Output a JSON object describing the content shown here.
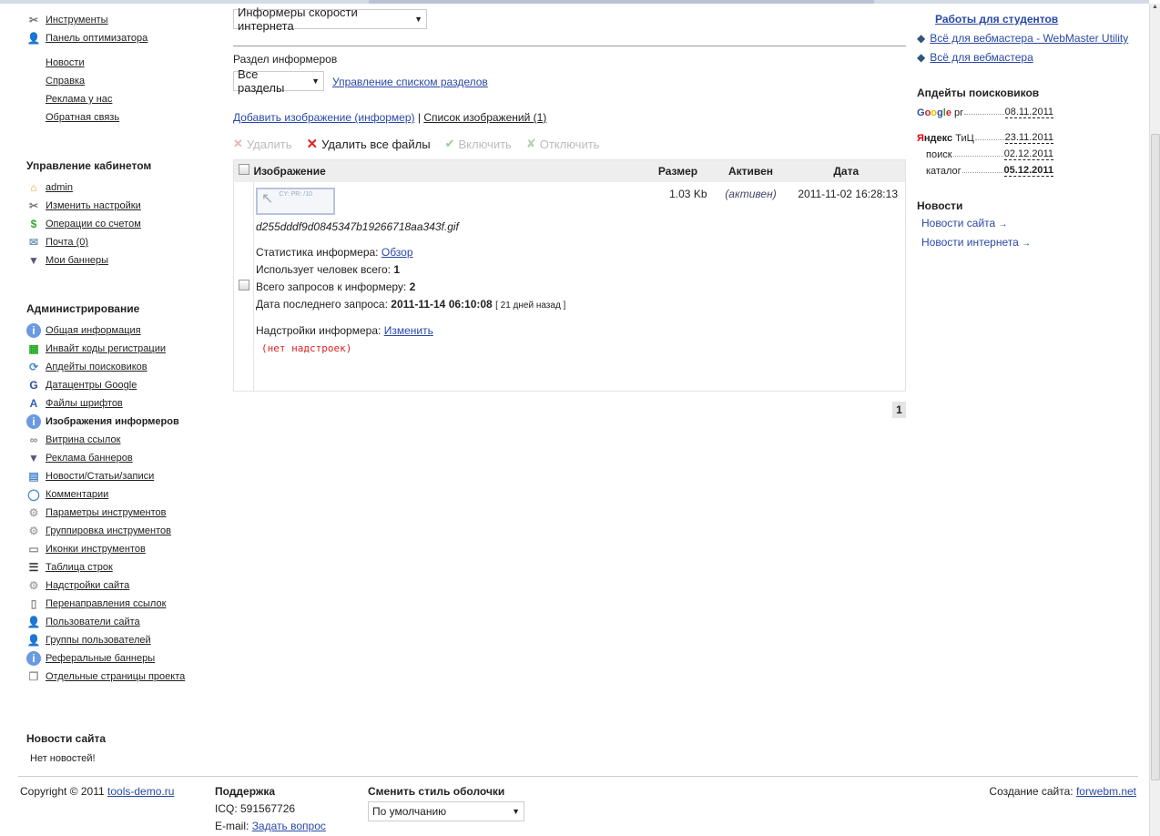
{
  "left_nav": {
    "top_items": [
      {
        "label": "Инструменты",
        "icon": "tools-icon"
      },
      {
        "label": "Панель оптимизатора",
        "icon": "user-icon"
      }
    ],
    "links": [
      "Новости",
      "Справка",
      "Реклама у нас",
      "Обратная связь"
    ],
    "cabinet": {
      "title": "Управление кабинетом",
      "items": [
        {
          "label": "admin",
          "icon": "home-icon"
        },
        {
          "label": "Изменить настройки",
          "icon": "tools-icon"
        },
        {
          "label": "Операции со счетом",
          "icon": "dollar-icon"
        },
        {
          "label": "Почта (0)",
          "icon": "mail-icon"
        },
        {
          "label": "Мои баннеры",
          "icon": "banner-icon"
        }
      ]
    },
    "admin": {
      "title": "Администрирование",
      "items": [
        {
          "label": "Общая информация",
          "icon": "info-icon"
        },
        {
          "label": "Инвайт коды регистрации",
          "icon": "code-icon"
        },
        {
          "label": "Апдейты поисковиков",
          "icon": "refresh-icon"
        },
        {
          "label": "Датацентры Google",
          "icon": "google-icon"
        },
        {
          "label": "Файлы шрифтов",
          "icon": "font-icon"
        },
        {
          "label": "Изображения информеров",
          "icon": "info-icon",
          "active": true
        },
        {
          "label": "Витрина ссылок",
          "icon": "link-icon"
        },
        {
          "label": "Реклама баннеров",
          "icon": "banner-icon"
        },
        {
          "label": "Новости/Статьи/записи",
          "icon": "news-icon"
        },
        {
          "label": "Комментарии",
          "icon": "comment-icon"
        },
        {
          "label": "Параметры инструментов",
          "icon": "gear-icon"
        },
        {
          "label": "Группировка инструментов",
          "icon": "gear-icon"
        },
        {
          "label": "Иконки инструментов",
          "icon": "folder-icon"
        },
        {
          "label": "Таблица строк",
          "icon": "table-icon"
        },
        {
          "label": "Надстройки сайта",
          "icon": "gear-icon"
        },
        {
          "label": "Перенаправления ссылок",
          "icon": "page-icon"
        },
        {
          "label": "Пользователи сайта",
          "icon": "user-icon"
        },
        {
          "label": "Группы пользователей",
          "icon": "user-icon"
        },
        {
          "label": "Реферальные баннеры",
          "icon": "info-icon"
        },
        {
          "label": "Отдельные страницы проекта",
          "icon": "pages-icon"
        }
      ]
    },
    "site_news": {
      "title": "Новости сайта",
      "text": "Нет новостей!"
    }
  },
  "main": {
    "informer_select": "Информеры скорости интернета",
    "section_label": "Раздел информеров",
    "section_select": "Все разделы",
    "manage_sections": "Управление списком разделов",
    "add_image": "Добавить изображение (информер)",
    "separator": "|",
    "image_list": "Список изображений (1)",
    "toolbar": {
      "delete": "Удалить",
      "delete_all": "Удалить все файлы",
      "enable": "Включить",
      "disable": "Отключить"
    },
    "table": {
      "headers": {
        "image": "Изображение",
        "size": "Размер",
        "active": "Активен",
        "date": "Дата"
      },
      "row": {
        "filename": "d255dddf9d0845347b19266718aa343f.gif",
        "size": "1.03 Kb",
        "active": "(активен)",
        "date": "2011-11-02 16:28:13",
        "stats_label": "Статистика информера:",
        "stats_link": "Обзор",
        "users_label": "Использует человек всего:",
        "users": "1",
        "requests_label": "Всего запросов к информеру:",
        "requests": "2",
        "last_label": "Дата последнего запроса:",
        "last": "2011-11-14 06:10:08",
        "last_ago": "[ 21 дней назад ]",
        "settings_label": "Надстройки информера:",
        "settings_link": "Изменить",
        "settings_none": "(нет надстроек)",
        "thumb_text": "CY: PR: /10"
      }
    },
    "page": "1"
  },
  "right": {
    "links": [
      "Работы для студентов",
      "Всё для вебмастера - WebMaster Utility",
      "Всё для вебмастера"
    ],
    "updates": {
      "title": "Апдейты поисковиков",
      "google_label": "pr",
      "google": "08.11.2011",
      "yandex_label": "ТиЦ",
      "yandex_tic": "23.11.2011",
      "search_label": "поиск",
      "search": "02.12.2011",
      "catalog_label": "каталог",
      "catalog": "05.12.2011"
    },
    "news": {
      "title": "Новости",
      "items": [
        "Новости сайта",
        "Новости интернета"
      ]
    }
  },
  "footer": {
    "copyright": "Copyright © 2011",
    "site": "tools-demo.ru",
    "support_title": "Поддержка",
    "icq": "ICQ: 591567726",
    "email_label": "E-mail:",
    "email_link": "Задать вопрос",
    "skin_title": "Сменить стиль оболочки",
    "skin_select": "По умолчанию",
    "created_label": "Создание сайта:",
    "created_link": "forwebm.net"
  }
}
